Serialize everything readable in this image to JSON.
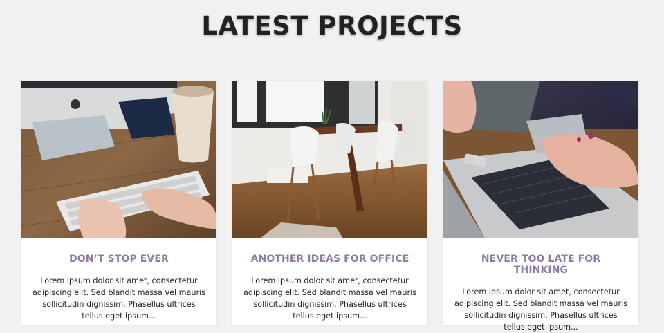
{
  "section": {
    "title": "LATEST PROJECTS"
  },
  "projects": [
    {
      "title": "DON’T STOP EVER",
      "excerpt": "Lorem ipsum dolor sit amet, consectetur adipiscing elit. Sed blandit massa vel mauris sollicitudin dignissim. Phasellus ultrices tellus eget ipsum...",
      "image": "desk-with-computer-keyboard-and-coffee-photo"
    },
    {
      "title": "ANOTHER IDEAS FOR OFFICE",
      "excerpt": "Lorem ipsum dolor sit amet, consectetur adipiscing elit. Sed blandit massa vel mauris sollicitudin dignissim. Phasellus ultrices tellus eget ipsum...",
      "image": "office-table-with-white-chairs-photo"
    },
    {
      "title": "NEVER TOO LATE FOR THINKING",
      "excerpt": "Lorem ipsum dolor sit amet, consectetur adipiscing elit. Sed blandit massa vel mauris sollicitudin dignissim. Phasellus ultrices tellus eget ipsum...",
      "image": "hands-with-phone-and-laptop-photo"
    }
  ],
  "colors": {
    "background": "#f1f1f1",
    "card_title": "#8c7ca8",
    "heading": "#222222"
  }
}
